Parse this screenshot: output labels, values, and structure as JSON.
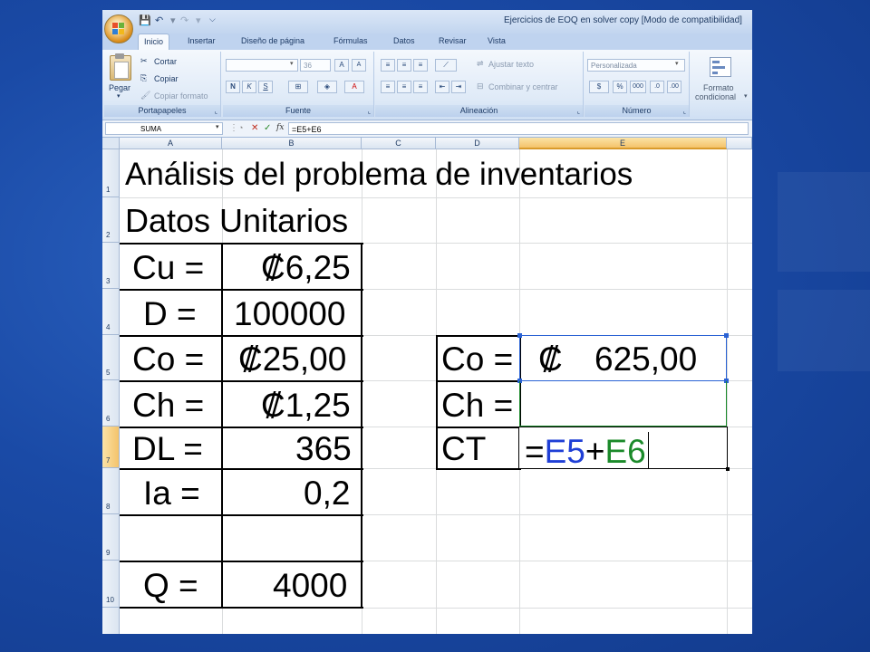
{
  "window": {
    "title": "Ejercicios de EOQ en solver copy  [Modo de compatibilidad]"
  },
  "ribbon": {
    "tabs": [
      "Inicio",
      "Insertar",
      "Diseño de página",
      "Fórmulas",
      "Datos",
      "Revisar",
      "Vista"
    ],
    "clipboard": {
      "paste": "Pegar",
      "cut": "Cortar",
      "copy": "Copiar",
      "format_painter": "Copiar formato",
      "label": "Portapapeles"
    },
    "font": {
      "size": "36",
      "label": "Fuente"
    },
    "alignment": {
      "wrap_text": "Ajustar texto",
      "merge_center": "Combinar y centrar",
      "label": "Alineación"
    },
    "number": {
      "format": "Personalizada",
      "label": "Número"
    },
    "styles": {
      "conditional_line1": "Formato",
      "conditional_line2": "condicional"
    }
  },
  "formula_bar": {
    "name_box": "SUMA",
    "formula": "=E5+E6"
  },
  "grid": {
    "columns": [
      "A",
      "B",
      "C",
      "D",
      "E"
    ],
    "rows": [
      "1",
      "2",
      "3",
      "4",
      "5",
      "6",
      "7",
      "8",
      "9",
      "10"
    ],
    "selected_column": "E",
    "selected_row": "7"
  },
  "cells": {
    "a1": "Análisis del problema de inventarios",
    "a2": "Datos Unitarios",
    "a3": "Cu =",
    "b3": "₡6,25",
    "a4": "D =",
    "b4": "100000",
    "a5": "Co =",
    "b5": "₡25,00",
    "a6": "Ch =",
    "b6": "₡1,25",
    "a7": "DL =",
    "b7": "365",
    "a8": "Ia =",
    "b8": "0,2",
    "a10": "Q =",
    "b10": "4000",
    "d5": "Co =",
    "e5_symbol": "₡",
    "e5_value": "625,00",
    "d6": "Ch =",
    "d7": "CT",
    "e7_edit": {
      "eq": "=",
      "ref1": "E5",
      "plus": "+",
      "ref2": "E6"
    }
  },
  "colors": {
    "ref1": "#1f3fd6",
    "ref2": "#1b8a2a",
    "selection": "#2a62d4"
  }
}
